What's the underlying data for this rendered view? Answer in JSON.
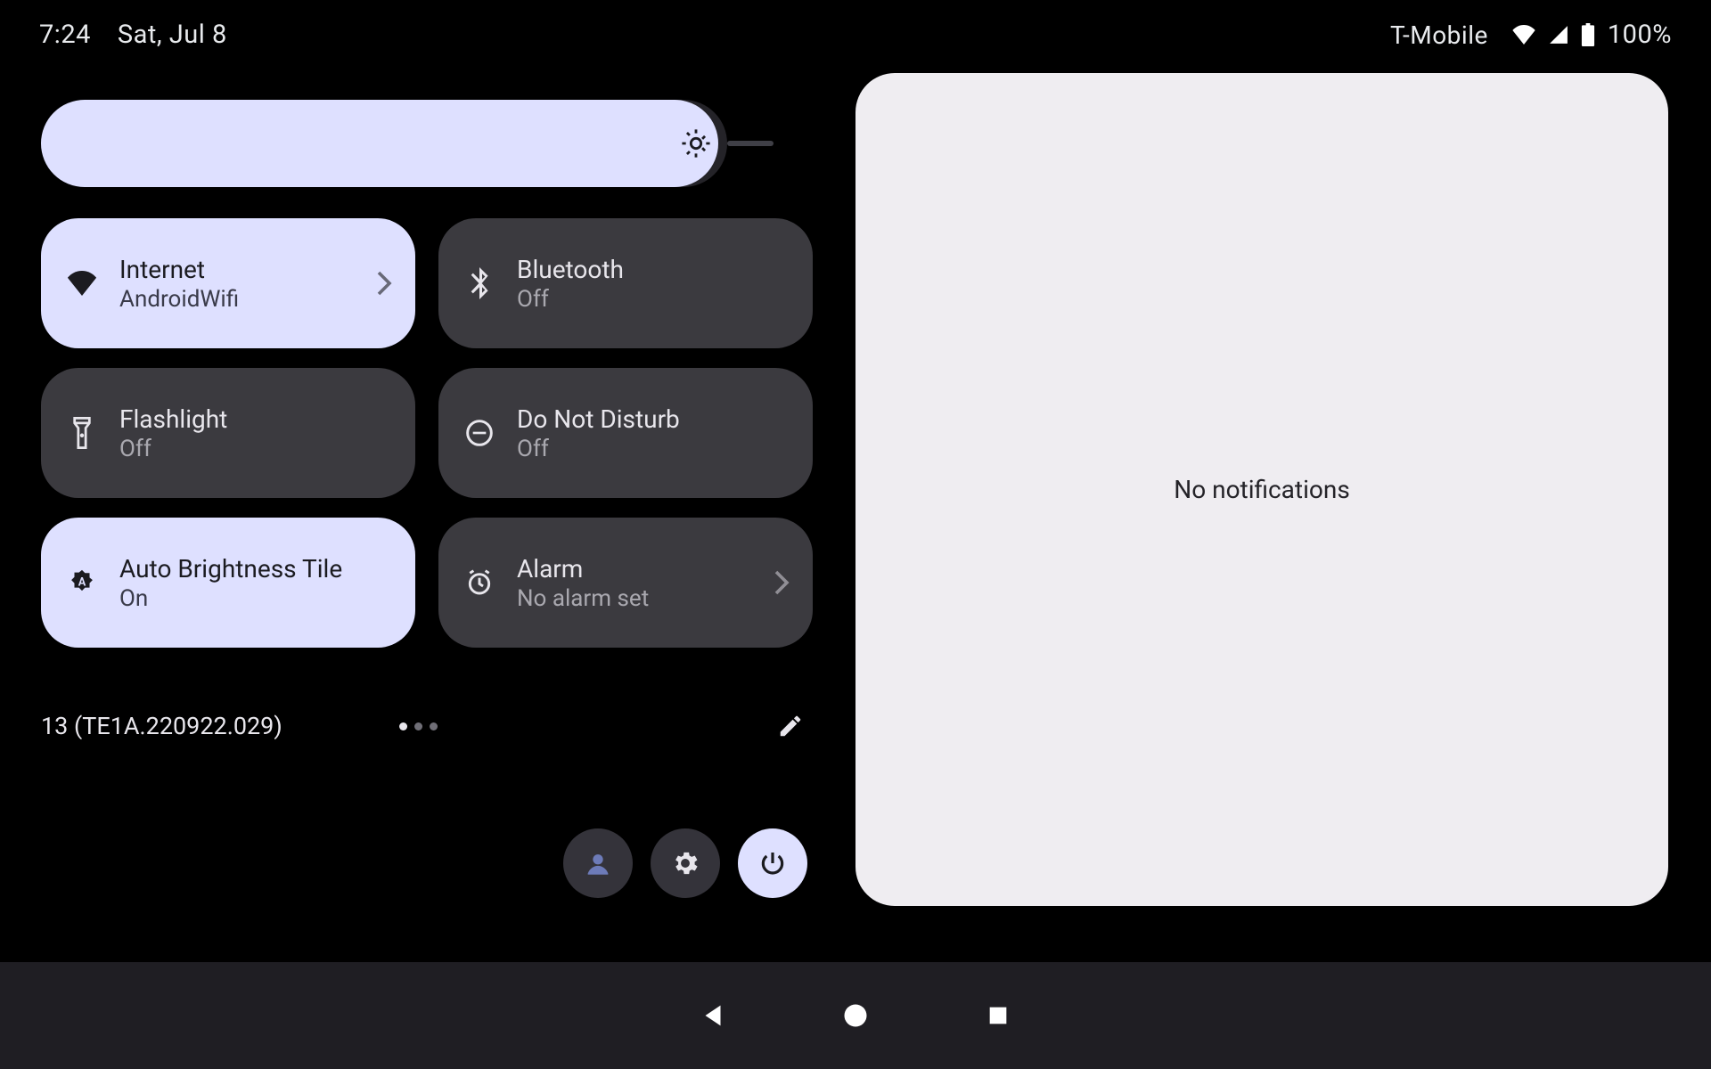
{
  "status": {
    "time": "7:24",
    "date": "Sat, Jul 8",
    "carrier": "T-Mobile",
    "battery_pct": "100%"
  },
  "brightness": {
    "icon": "brightness-icon",
    "level_pct": 98
  },
  "tiles": [
    {
      "key": "internet",
      "title": "Internet",
      "sub": "AndroidWifi",
      "state": "on",
      "icon": "wifi-icon",
      "chevron": true
    },
    {
      "key": "bluetooth",
      "title": "Bluetooth",
      "sub": "Off",
      "state": "off",
      "icon": "bluetooth-icon",
      "chevron": false
    },
    {
      "key": "flashlight",
      "title": "Flashlight",
      "sub": "Off",
      "state": "off",
      "icon": "flashlight-icon",
      "chevron": false
    },
    {
      "key": "dnd",
      "title": "Do Not Disturb",
      "sub": "Off",
      "state": "off",
      "icon": "dnd-icon",
      "chevron": false
    },
    {
      "key": "autobright",
      "title": "Auto Brightness Tile",
      "sub": "On",
      "state": "on",
      "icon": "auto-brightness-icon",
      "chevron": false
    },
    {
      "key": "alarm",
      "title": "Alarm",
      "sub": "No alarm set",
      "state": "off",
      "icon": "alarm-icon",
      "chevron": true
    }
  ],
  "footer": {
    "build": "13 (TE1A.220922.029)",
    "page_count": 3,
    "active_page": 0
  },
  "notifications": {
    "empty_text": "No notifications"
  },
  "colors": {
    "tile_on_bg": "#dee0ff",
    "tile_off_bg": "#3b3a3f",
    "card_bg": "#efedf1"
  }
}
